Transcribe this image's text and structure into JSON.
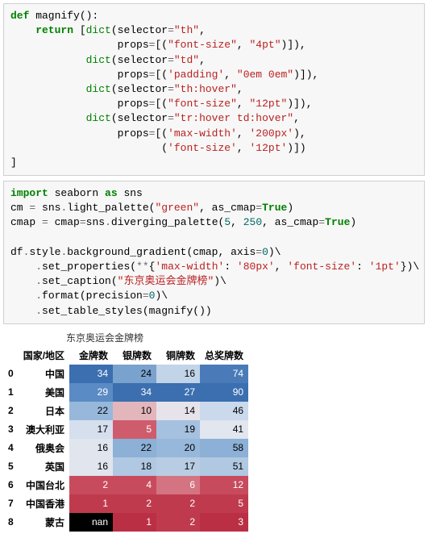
{
  "code1": {
    "l1a": "def",
    "l1b": " magnify():",
    "l2a": "    return",
    "l2b": " [",
    "l2c": "dict",
    "l2d": "(selector",
    "l2e": "=",
    "l2f": "\"th\"",
    "l2g": ",",
    "l3a": "                 props",
    "l3b": "=",
    "l3c": "[(",
    "l3d": "\"font-size\"",
    "l3e": ", ",
    "l3f": "\"4pt\"",
    "l3g": ")]),",
    "l4a": "            ",
    "l4b": "dict",
    "l4c": "(selector",
    "l4d": "=",
    "l4e": "\"td\"",
    "l4f": ",",
    "l5a": "                 props",
    "l5b": "=",
    "l5c": "[(",
    "l5d": "'padding'",
    "l5e": ", ",
    "l5f": "\"0em 0em\"",
    "l5g": ")]),",
    "l6a": "            ",
    "l6b": "dict",
    "l6c": "(selector",
    "l6d": "=",
    "l6e": "\"th:hover\"",
    "l6f": ",",
    "l7a": "                 props",
    "l7b": "=",
    "l7c": "[(",
    "l7d": "\"font-size\"",
    "l7e": ", ",
    "l7f": "\"12pt\"",
    "l7g": ")]),",
    "l8a": "            ",
    "l8b": "dict",
    "l8c": "(selector",
    "l8d": "=",
    "l8e": "\"tr:hover td:hover\"",
    "l8f": ",",
    "l9a": "                 props",
    "l9b": "=",
    "l9c": "[(",
    "l9d": "'max-width'",
    "l9e": ", ",
    "l9f": "'200px'",
    "l9g": "),",
    "l10a": "                        (",
    "l10b": "'font-size'",
    "l10c": ", ",
    "l10d": "'12pt'",
    "l10e": ")])",
    "l11": "]"
  },
  "code2": {
    "l1a": "import",
    "l1b": " seaborn ",
    "l1c": "as",
    "l1d": " sns",
    "l2a": "cm ",
    "l2b": "=",
    "l2c": " sns",
    "l2d": ".",
    "l2e": "light_palette(",
    "l2f": "\"green\"",
    "l2g": ", as_cmap",
    "l2h": "=",
    "l2i": "True",
    "l2j": ")",
    "l3a": "cmap ",
    "l3b": "=",
    "l3c": " cmap",
    "l3d": "=",
    "l3e": "sns",
    "l3f": ".",
    "l3g": "diverging_palette(",
    "l3h": "5",
    "l3i": ", ",
    "l3j": "250",
    "l3k": ", as_cmap",
    "l3l": "=",
    "l3m": "True",
    "l3n": ")",
    "l4": "",
    "l5a": "df",
    "l5b": ".",
    "l5c": "style",
    "l5d": ".",
    "l5e": "background_gradient(cmap, axis",
    "l5f": "=",
    "l5g": "0",
    "l5h": ")\\",
    "l6a": "    ",
    "l6b": ".",
    "l6c": "set_properties(",
    "l6d": "**",
    "l6e": "{",
    "l6f": "'max-width'",
    "l6g": ": ",
    "l6h": "'80px'",
    "l6i": ", ",
    "l6j": "'font-size'",
    "l6k": ": ",
    "l6l": "'1pt'",
    "l6m": "})\\",
    "l7a": "    ",
    "l7b": ".",
    "l7c": "set_caption(",
    "l7d": "\"东京奥运会金牌榜\"",
    "l7e": ")\\",
    "l8a": "    ",
    "l8b": ".",
    "l8c": "format(precision",
    "l8d": "=",
    "l8e": "0",
    "l8f": ")\\",
    "l9a": "    ",
    "l9b": ".",
    "l9c": "set_table_styles(magnify())"
  },
  "table": {
    "caption": "东京奥运会金牌榜",
    "headers": [
      "国家/地区",
      "金牌数",
      "银牌数",
      "铜牌数",
      "总奖牌数"
    ],
    "rows": [
      {
        "idx": "0",
        "region": "中国",
        "cells": [
          {
            "v": "34",
            "bg": "#3b6fb0",
            "fg": "#fff"
          },
          {
            "v": "24",
            "bg": "#7aa2cf",
            "fg": "#000"
          },
          {
            "v": "16",
            "bg": "#c2d4e8",
            "fg": "#000"
          },
          {
            "v": "74",
            "bg": "#4a7bb8",
            "fg": "#fff"
          }
        ]
      },
      {
        "idx": "1",
        "region": "美国",
        "cells": [
          {
            "v": "29",
            "bg": "#5b8bc4",
            "fg": "#fff"
          },
          {
            "v": "34",
            "bg": "#3b6fb0",
            "fg": "#fff"
          },
          {
            "v": "27",
            "bg": "#3b6fb0",
            "fg": "#fff"
          },
          {
            "v": "90",
            "bg": "#3b6fb0",
            "fg": "#fff"
          }
        ]
      },
      {
        "idx": "2",
        "region": "日本",
        "cells": [
          {
            "v": "22",
            "bg": "#97b8db",
            "fg": "#000"
          },
          {
            "v": "10",
            "bg": "#e3b6bc",
            "fg": "#000"
          },
          {
            "v": "14",
            "bg": "#e6e4ea",
            "fg": "#000"
          },
          {
            "v": "46",
            "bg": "#cad9ec",
            "fg": "#000"
          }
        ]
      },
      {
        "idx": "3",
        "region": "澳大利亚",
        "cells": [
          {
            "v": "17",
            "bg": "#d5dfee",
            "fg": "#000"
          },
          {
            "v": "5",
            "bg": "#cf5c6c",
            "fg": "#fff"
          },
          {
            "v": "19",
            "bg": "#a5c1df",
            "fg": "#000"
          },
          {
            "v": "41",
            "bg": "#e1e6ef",
            "fg": "#000"
          }
        ]
      },
      {
        "idx": "4",
        "region": "俄奥会",
        "cells": [
          {
            "v": "16",
            "bg": "#e0e5ee",
            "fg": "#000"
          },
          {
            "v": "22",
            "bg": "#8cb0d6",
            "fg": "#000"
          },
          {
            "v": "20",
            "bg": "#97b8db",
            "fg": "#000"
          },
          {
            "v": "58",
            "bg": "#8cb0d6",
            "fg": "#000"
          }
        ]
      },
      {
        "idx": "5",
        "region": "英国",
        "cells": [
          {
            "v": "16",
            "bg": "#e0e5ee",
            "fg": "#000"
          },
          {
            "v": "18",
            "bg": "#b0c8e1",
            "fg": "#000"
          },
          {
            "v": "17",
            "bg": "#b8cde3",
            "fg": "#000"
          },
          {
            "v": "51",
            "bg": "#b0c8e1",
            "fg": "#000"
          }
        ]
      },
      {
        "idx": "6",
        "region": "中国台北",
        "cells": [
          {
            "v": "2",
            "bg": "#c84b5d",
            "fg": "#fff"
          },
          {
            "v": "4",
            "bg": "#c84b5d",
            "fg": "#fff"
          },
          {
            "v": "6",
            "bg": "#d47482",
            "fg": "#fff"
          },
          {
            "v": "12",
            "bg": "#c84b5d",
            "fg": "#fff"
          }
        ]
      },
      {
        "idx": "7",
        "region": "中国香港",
        "cells": [
          {
            "v": "1",
            "bg": "#c03a4e",
            "fg": "#fff"
          },
          {
            "v": "2",
            "bg": "#c03a4e",
            "fg": "#fff"
          },
          {
            "v": "2",
            "bg": "#c03a4e",
            "fg": "#fff"
          },
          {
            "v": "5",
            "bg": "#c03a4e",
            "fg": "#fff"
          }
        ]
      },
      {
        "idx": "8",
        "region": "蒙古",
        "cells": [
          {
            "v": "nan",
            "bg": "#000000",
            "fg": "#fff"
          },
          {
            "v": "1",
            "bg": "#bb2f44",
            "fg": "#fff"
          },
          {
            "v": "2",
            "bg": "#c03a4e",
            "fg": "#fff"
          },
          {
            "v": "3",
            "bg": "#bb2f44",
            "fg": "#fff"
          }
        ]
      }
    ]
  },
  "chart_data": {
    "type": "table",
    "title": "东京奥运会金牌榜",
    "columns": [
      "国家/地区",
      "金牌数",
      "银牌数",
      "铜牌数",
      "总奖牌数"
    ],
    "index": [
      0,
      1,
      2,
      3,
      4,
      5,
      6,
      7,
      8
    ],
    "data": [
      [
        "中国",
        34,
        24,
        16,
        74
      ],
      [
        "美国",
        29,
        34,
        27,
        90
      ],
      [
        "日本",
        22,
        10,
        14,
        46
      ],
      [
        "澳大利亚",
        17,
        5,
        19,
        41
      ],
      [
        "俄奥会",
        16,
        22,
        20,
        58
      ],
      [
        "英国",
        16,
        18,
        17,
        51
      ],
      [
        "中国台北",
        2,
        4,
        6,
        12
      ],
      [
        "中国香港",
        1,
        2,
        2,
        5
      ],
      [
        "蒙古",
        null,
        1,
        2,
        3
      ]
    ]
  }
}
